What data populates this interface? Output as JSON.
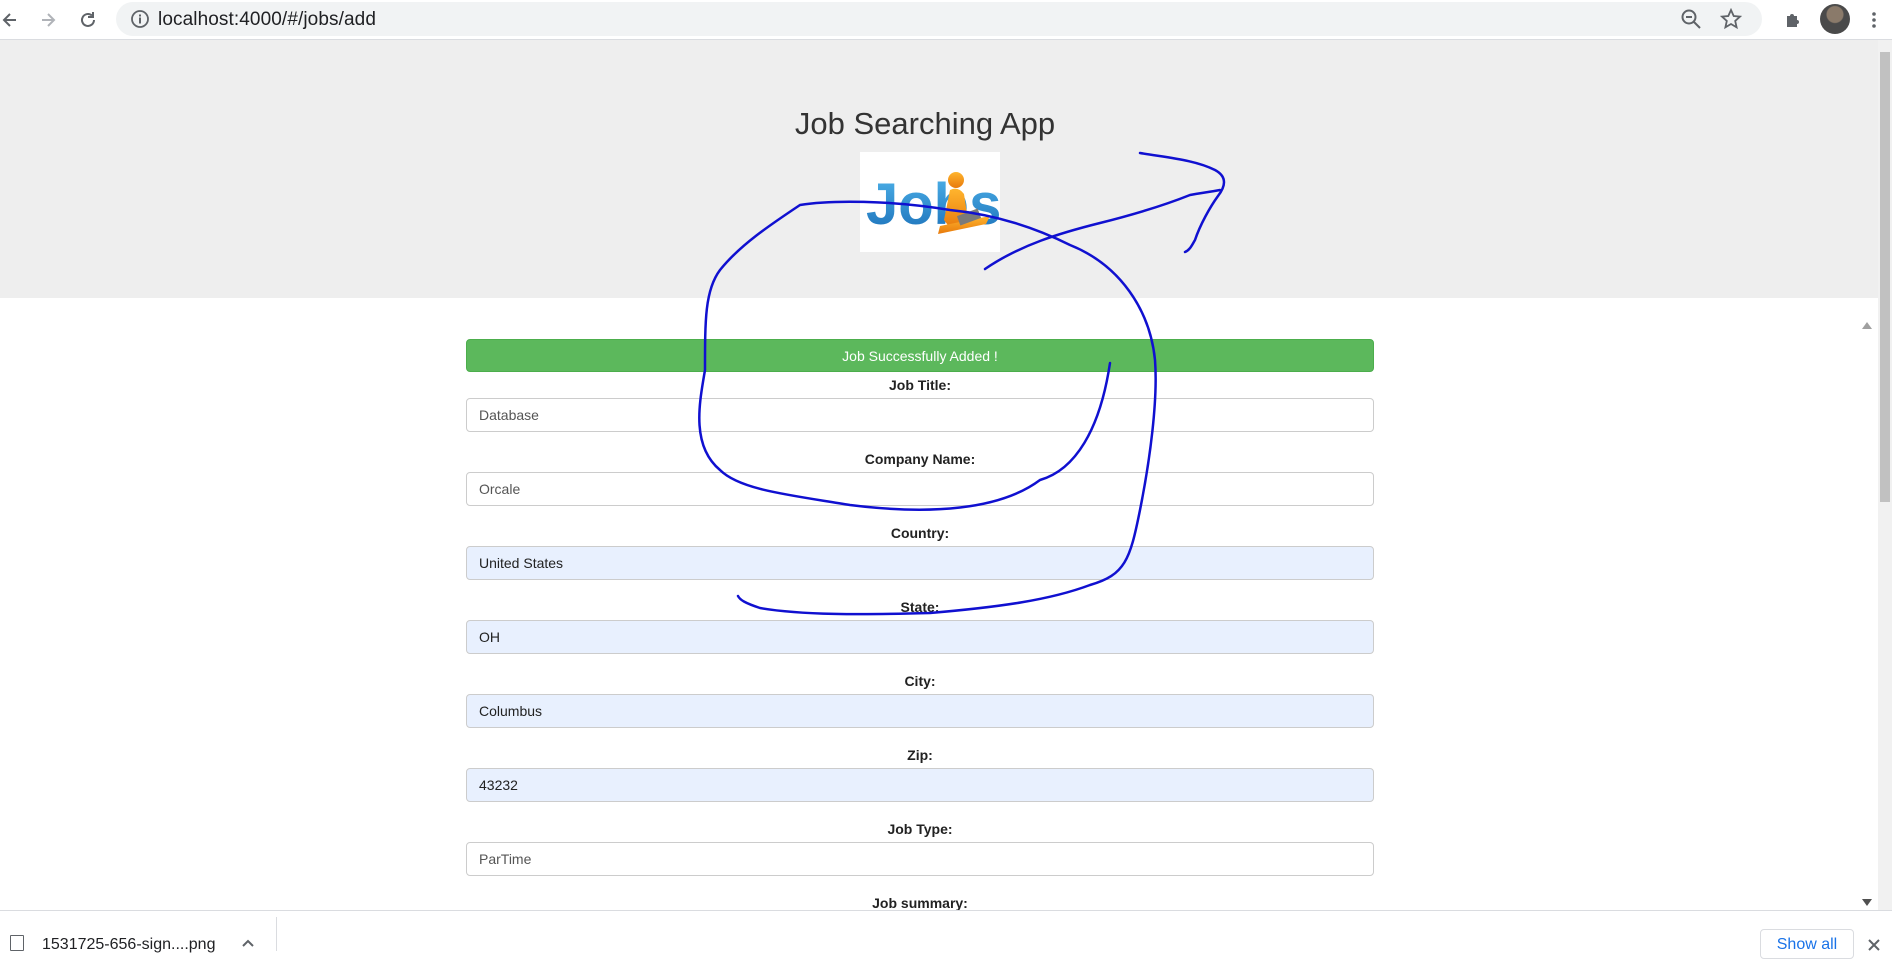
{
  "browser": {
    "url": "localhost:4000/#/jobs/add"
  },
  "app": {
    "title": "Job Searching App",
    "logo_text": "Jobs"
  },
  "alert": {
    "message": "Job Successfully Added !"
  },
  "form": {
    "fields": [
      {
        "label": "Job Title:",
        "value": "Database",
        "autofilled": false
      },
      {
        "label": "Company Name:",
        "value": "Orcale",
        "autofilled": false
      },
      {
        "label": "Country:",
        "value": "United States",
        "autofilled": true
      },
      {
        "label": "State:",
        "value": "OH",
        "autofilled": true
      },
      {
        "label": "City:",
        "value": "Columbus",
        "autofilled": true
      },
      {
        "label": "Zip:",
        "value": "43232",
        "autofilled": true
      },
      {
        "label": "Job Type:",
        "value": "ParTime",
        "autofilled": false
      }
    ],
    "summary_label": "Job summary:"
  },
  "downloads": {
    "file_name": "1531725-656-sign....png",
    "show_all_label": "Show all"
  },
  "colors": {
    "success": "#5cb85c",
    "autofill_bg": "#e8f0fe",
    "annotation_ink": "#1010d0",
    "jumbotron_bg": "#eeeeee"
  }
}
